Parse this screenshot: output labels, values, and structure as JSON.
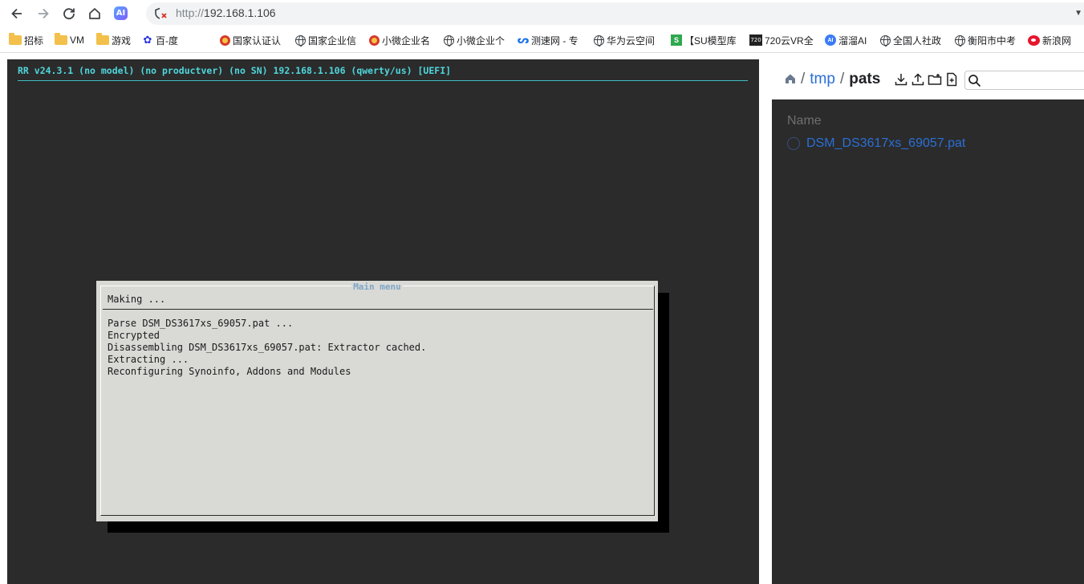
{
  "browser": {
    "url_scheme": "http://",
    "url_host": "192.168.1.106",
    "ai_badge": "AI"
  },
  "bookmarks": [
    {
      "label": "招标",
      "icon": "folder-icon"
    },
    {
      "label": "VM",
      "icon": "folder-icon"
    },
    {
      "label": "游戏",
      "icon": "folder-icon"
    },
    {
      "label": "百-度",
      "icon": "baidu-paw-icon"
    },
    {
      "label": "国家认证认",
      "icon": "national-emblem-icon"
    },
    {
      "label": "国家企业信",
      "icon": "globe-icon"
    },
    {
      "label": "小微企业名",
      "icon": "national-emblem-icon"
    },
    {
      "label": "小微企业个",
      "icon": "globe-icon"
    },
    {
      "label": "测速网 - 专",
      "icon": "speedtest-icon"
    },
    {
      "label": "华为云空间",
      "icon": "globe-icon"
    },
    {
      "label": "【SU模型库",
      "icon": "su-model-icon"
    },
    {
      "label": "720云VR全",
      "icon": "720yun-icon"
    },
    {
      "label": "溜溜AI",
      "icon": "liuliu-ai-icon"
    },
    {
      "label": "全国人社政",
      "icon": "globe-icon"
    },
    {
      "label": "衡阳市中考",
      "icon": "globe-icon"
    },
    {
      "label": "新浪网",
      "icon": "weibo-icon"
    }
  ],
  "terminal": {
    "header": "RR v24.3.1 (no model) (no productver) (no SN) 192.168.1.106 (qwerty/us) [UEFI]",
    "dialog": {
      "title": "Main menu",
      "status": "Making ...",
      "lines": [
        "Parse DSM_DS3617xs_69057.pat ...",
        "Encrypted",
        "Disassembling DSM_DS3617xs_69057.pat: Extractor cached.",
        "Extracting ...",
        "Reconfiguring Synoinfo, Addons and Modules"
      ]
    }
  },
  "file_browser": {
    "breadcrumb": {
      "sep": "/",
      "tmp": "tmp",
      "current": "pats"
    },
    "column_name": "Name",
    "files": [
      {
        "name": "DSM_DS3617xs_69057.pat"
      }
    ]
  }
}
